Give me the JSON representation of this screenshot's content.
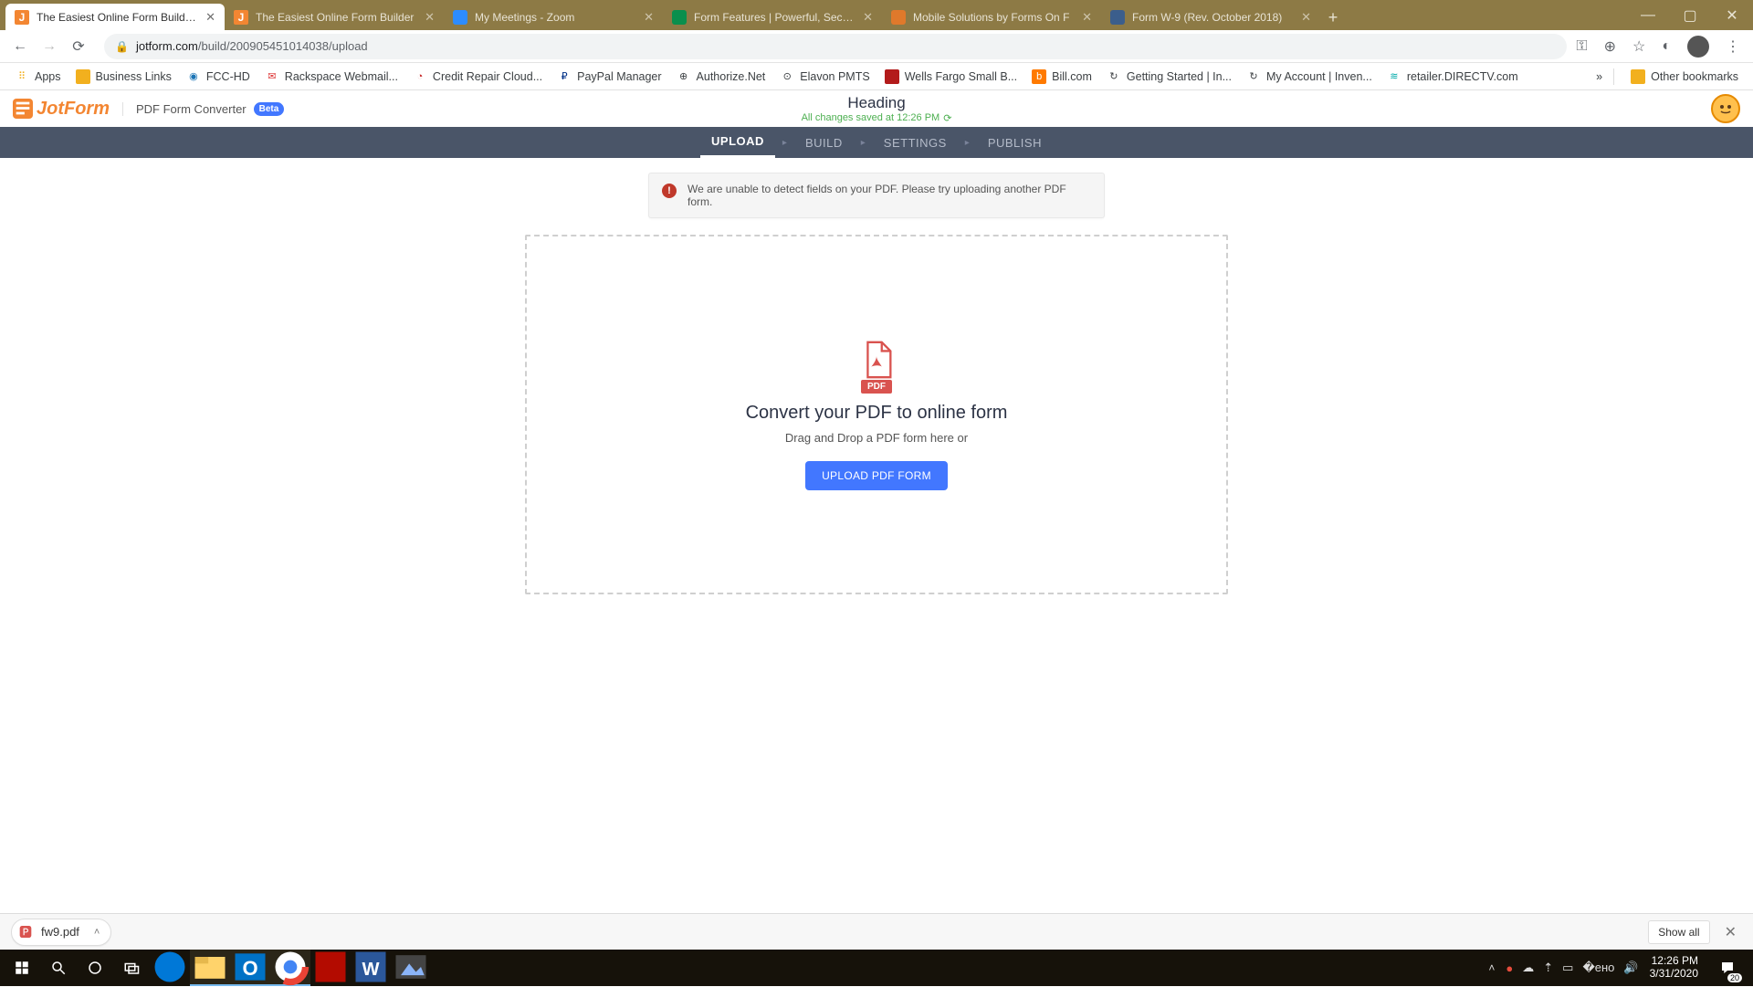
{
  "tabs": [
    {
      "title": "The Easiest Online Form Builder |",
      "favicon": "#f38632"
    },
    {
      "title": "The Easiest Online Form Builder",
      "favicon": "#f38632"
    },
    {
      "title": "My Meetings - Zoom",
      "favicon": "#2d8cff"
    },
    {
      "title": "Form Features | Powerful, Secure",
      "favicon": "#0a8f4d"
    },
    {
      "title": "Mobile Solutions by Forms On F",
      "favicon": "#e0792b"
    },
    {
      "title": "Form W-9 (Rev. October 2018)",
      "favicon": "#3b5e8c"
    }
  ],
  "url": {
    "domain": "jotform.com",
    "path": "/build/200905451014038/upload"
  },
  "bookmarks": [
    {
      "label": "Apps",
      "icon": "⠿",
      "color": "#f2b01e"
    },
    {
      "label": "Business Links",
      "icon": "▮",
      "color": "#f2b01e"
    },
    {
      "label": "FCC-HD",
      "icon": "◉",
      "color": "#1b74b5"
    },
    {
      "label": "Rackspace Webmail...",
      "icon": "✉",
      "color": "#d33"
    },
    {
      "label": "Credit Repair Cloud...",
      "icon": "◔",
      "color": "#c62828"
    },
    {
      "label": "PayPal Manager",
      "icon": "₽",
      "color": "#003087"
    },
    {
      "label": "Authorize.Net",
      "icon": "⊕",
      "color": "#555"
    },
    {
      "label": "Elavon PMTS",
      "icon": "⊙",
      "color": "#555"
    },
    {
      "label": "Wells Fargo Small B...",
      "icon": "■",
      "color": "#b31b1b"
    },
    {
      "label": "Bill.com",
      "icon": "b",
      "color": "#ff7a00"
    },
    {
      "label": "Getting Started | In...",
      "icon": "↻",
      "color": "#555"
    },
    {
      "label": "My Account | Inven...",
      "icon": "↻",
      "color": "#555"
    },
    {
      "label": "retailer.DIRECTV.com",
      "icon": "≋",
      "color": "#0aa"
    }
  ],
  "other_bookmarks": "Other bookmarks",
  "app": {
    "logo": "JotForm",
    "product": "PDF Form Converter",
    "beta": "Beta",
    "heading": "Heading",
    "saved": "All changes saved at 12:26 PM"
  },
  "stages": {
    "upload": "UPLOAD",
    "build": "BUILD",
    "settings": "SETTINGS",
    "publish": "PUBLISH"
  },
  "alert": "We are unable to detect fields on your PDF. Please try uploading another PDF form.",
  "dropzone": {
    "badge": "PDF",
    "title": "Convert your PDF to online form",
    "sub": "Drag and Drop a PDF form here or",
    "button": "UPLOAD PDF FORM"
  },
  "downloads": {
    "file": "fw9.pdf",
    "showall": "Show all"
  },
  "taskbar": {
    "time": "12:26 PM",
    "date": "3/31/2020",
    "notif": "20"
  }
}
